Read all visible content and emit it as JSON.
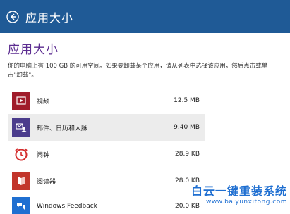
{
  "header": {
    "title": "应用大小",
    "color": "#1f5a96"
  },
  "main": {
    "title": "应用大小",
    "description": "你的电脑上有 100 GB 的可用空间。如果要卸载某个应用，请从列表中选择该应用，然后点击或单击\"卸载\"。",
    "apps": [
      {
        "name": "视频",
        "size": "12.5 MB",
        "icon": "video-icon",
        "color": "#a01b2a",
        "selected": false
      },
      {
        "name": "邮件、日历和人脉",
        "size": "9.40 MB",
        "icon": "mail-calendar-people-icon",
        "color": "#4b3c8c",
        "selected": true
      },
      {
        "name": "闹钟",
        "size": "28.9 KB",
        "icon": "alarm-clock-icon",
        "color": "#d42d2d",
        "selected": false
      },
      {
        "name": "阅读器",
        "size": "28.0 KB",
        "icon": "reader-icon",
        "color": "#c2352b",
        "selected": false
      },
      {
        "name": "Windows Feedback",
        "size": "20.0 KB",
        "icon": "windows-feedback-icon",
        "color": "#1f6fd1",
        "selected": false
      }
    ]
  },
  "watermark": {
    "title": "白云一键重装系统",
    "url": "www.baiyunxitong.com"
  }
}
